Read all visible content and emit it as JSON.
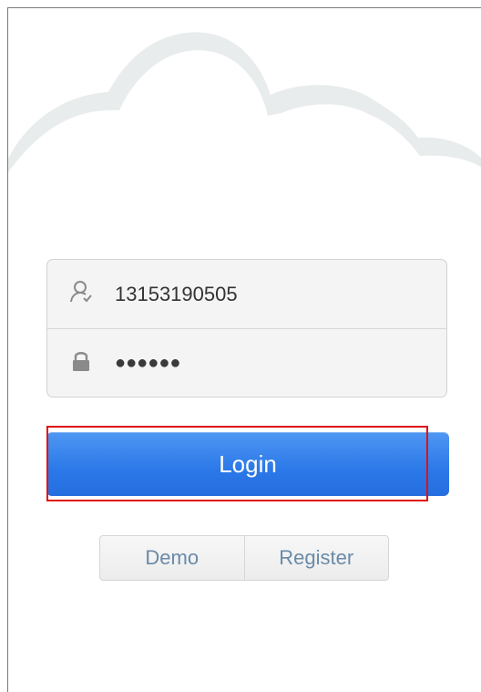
{
  "login": {
    "username_value": "13153190505",
    "password_masked": "●●●●●●",
    "username_icon": "user-icon",
    "password_icon": "lock-icon"
  },
  "actions": {
    "login_label": "Login",
    "demo_label": "Demo",
    "register_label": "Register"
  },
  "colors": {
    "primary": "#2b78e8",
    "link": "#6a8aa8",
    "highlight": "#e01010",
    "cloud": "#e9ecec"
  }
}
